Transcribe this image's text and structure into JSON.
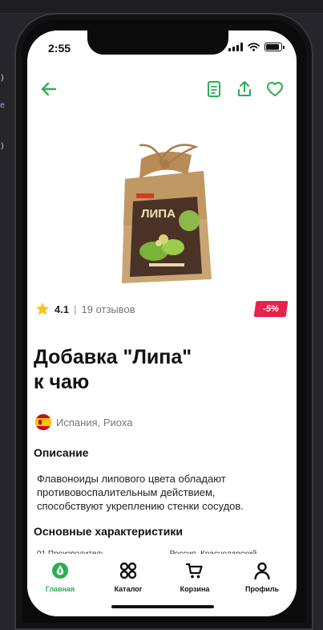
{
  "background": {
    "lines": [
      ")",
      "e",
      ")"
    ]
  },
  "status_bar": {
    "time": "2:55"
  },
  "top_bar": {
    "back_icon": "arrow-left-icon",
    "document_icon": "document-icon",
    "share_icon": "share-icon",
    "favorite_icon": "heart-icon",
    "accent_color": "#2dad55"
  },
  "product": {
    "image_label": "ЛИПА",
    "rating_score": "4.1",
    "rating_separator": "|",
    "reviews": "19 отзывов",
    "discount": "-5%",
    "title_line1": "Добавка \"Липа\"",
    "title_line2": "к чаю",
    "origin": "Испания, Риоха",
    "description_title": "Описание",
    "description": "Флавоноиды липового цвета обладают противовоспалительным действием, способствуют укреплению стенки сосудов.",
    "characteristics_title": "Основные характеристики",
    "characteristics_row": "01.Производитель.............................Россия, Краснодарский"
  },
  "tabbar": {
    "items": [
      {
        "label": "Главная",
        "icon": "spar-logo-icon",
        "active": true
      },
      {
        "label": "Каталог",
        "icon": "grid-icon",
        "active": false
      },
      {
        "label": "Корзина",
        "icon": "cart-icon",
        "active": false
      },
      {
        "label": "Профиль",
        "icon": "user-icon",
        "active": false
      }
    ]
  }
}
